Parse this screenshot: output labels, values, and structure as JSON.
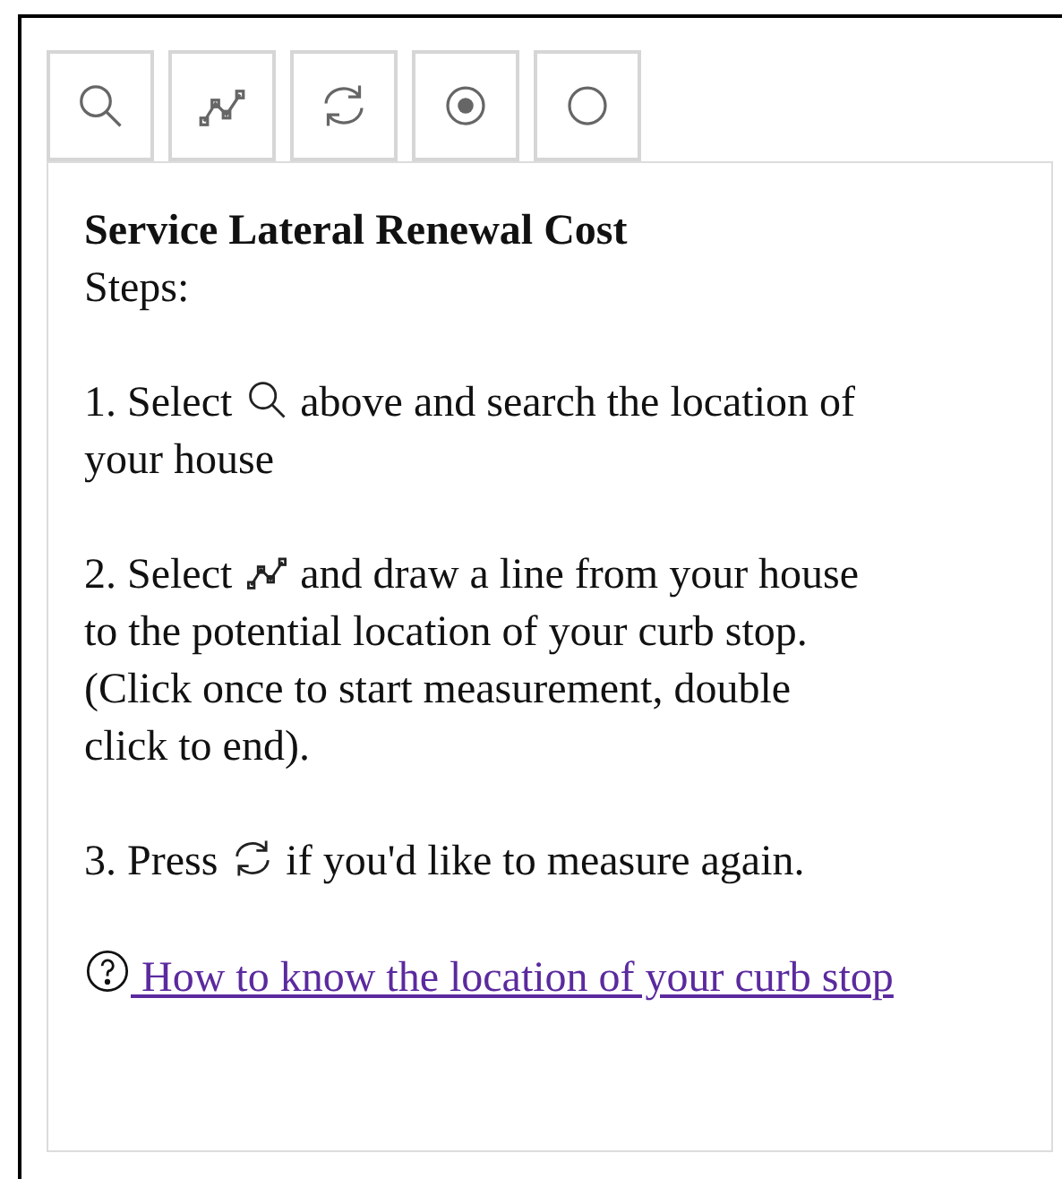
{
  "toolbar": [
    {
      "kind": "search"
    },
    {
      "kind": "polyline"
    },
    {
      "kind": "refresh"
    },
    {
      "kind": "target"
    },
    {
      "kind": "circle"
    }
  ],
  "panel": {
    "title": "Service Lateral Renewal Cost",
    "subtitle": "Steps:",
    "steps": [
      {
        "before": "1. Select",
        "kind": "search",
        "lines": [
          "above and search the location of",
          "your house"
        ]
      },
      {
        "before": "2. Select",
        "kind": "polyline",
        "lines": [
          "and draw a line from your house",
          "to the potential location of your curb stop.",
          "(Click once to start measurement, double",
          "click to end)."
        ]
      },
      {
        "before": "3. Press",
        "kind": "refresh",
        "lines": [
          "if you'd like to measure again."
        ]
      }
    ],
    "help_link": " How to know the location of your curb stop"
  }
}
